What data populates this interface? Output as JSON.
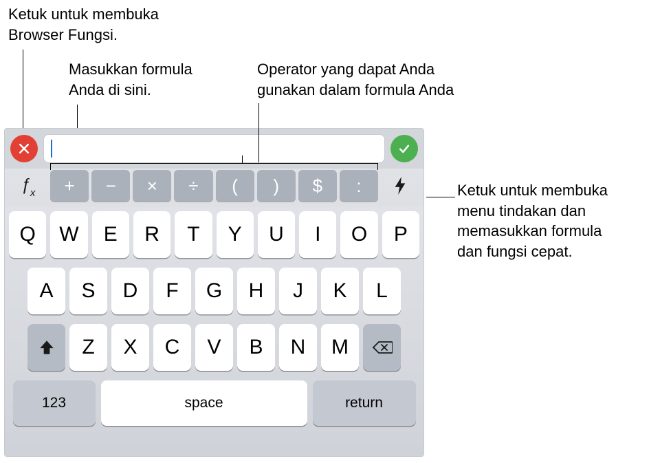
{
  "callouts": {
    "fxBrowser": "Ketuk untuk membuka\nBrowser Fungsi.",
    "formulaInput": "Masukkan formula\nAnda di sini.",
    "operators": "Operator yang dapat Anda\ngunakan dalam formula Anda",
    "actionMenu": "Ketuk untuk membuka\nmenu tindakan dan\nmemasukkan formula\ndan fungsi cepat."
  },
  "formulaBar": {
    "cancelIcon": "close-icon",
    "acceptIcon": "checkmark-icon",
    "value": ""
  },
  "operatorRow": {
    "fxLabel": "ƒx",
    "operators": [
      "+",
      "−",
      "×",
      "÷",
      "(",
      ")",
      "$",
      ":"
    ],
    "boltIcon": "bolt-icon"
  },
  "keyboard": {
    "row1": [
      "Q",
      "W",
      "E",
      "R",
      "T",
      "Y",
      "U",
      "I",
      "O",
      "P"
    ],
    "row2": [
      "A",
      "S",
      "D",
      "F",
      "G",
      "H",
      "J",
      "K",
      "L"
    ],
    "row3": [
      "Z",
      "X",
      "C",
      "V",
      "B",
      "N",
      "M"
    ],
    "numKey": "123",
    "spaceKey": "space",
    "returnKey": "return"
  }
}
